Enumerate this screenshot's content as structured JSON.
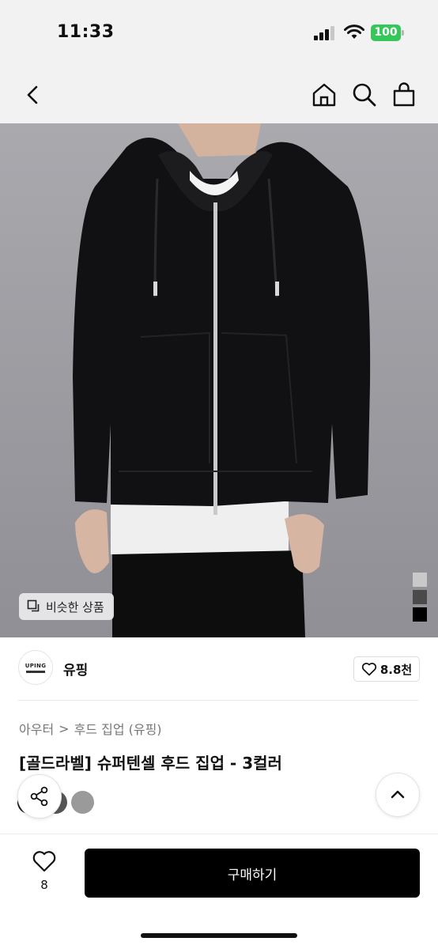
{
  "status_bar": {
    "time": "11:33",
    "battery": "100"
  },
  "nav": {
    "icons": [
      "back-chevron-icon",
      "home-icon",
      "search-icon",
      "shopping-bag-icon"
    ]
  },
  "image": {
    "similar_label": "비슷한 상품",
    "swatches": [
      "#c9c9c9",
      "#4a4a4a",
      "#000000"
    ]
  },
  "brand": {
    "logo_text": "UPING",
    "name": "유핑",
    "likes": "8.8천"
  },
  "breadcrumb": {
    "level1": "아우터",
    "separator": ">",
    "level2": "후드 집업 (유핑)"
  },
  "product": {
    "title": "[골드라벨] 슈퍼텐셀 후드 집업 - 3컬러",
    "colors": [
      "#111111",
      "#555555",
      "#9a9a9a"
    ]
  },
  "bottom": {
    "wish_count": "8",
    "buy_label": "구매하기"
  },
  "colors": {
    "accent": "#000000",
    "battery": "#35c759",
    "background": "#f2f2f2"
  }
}
